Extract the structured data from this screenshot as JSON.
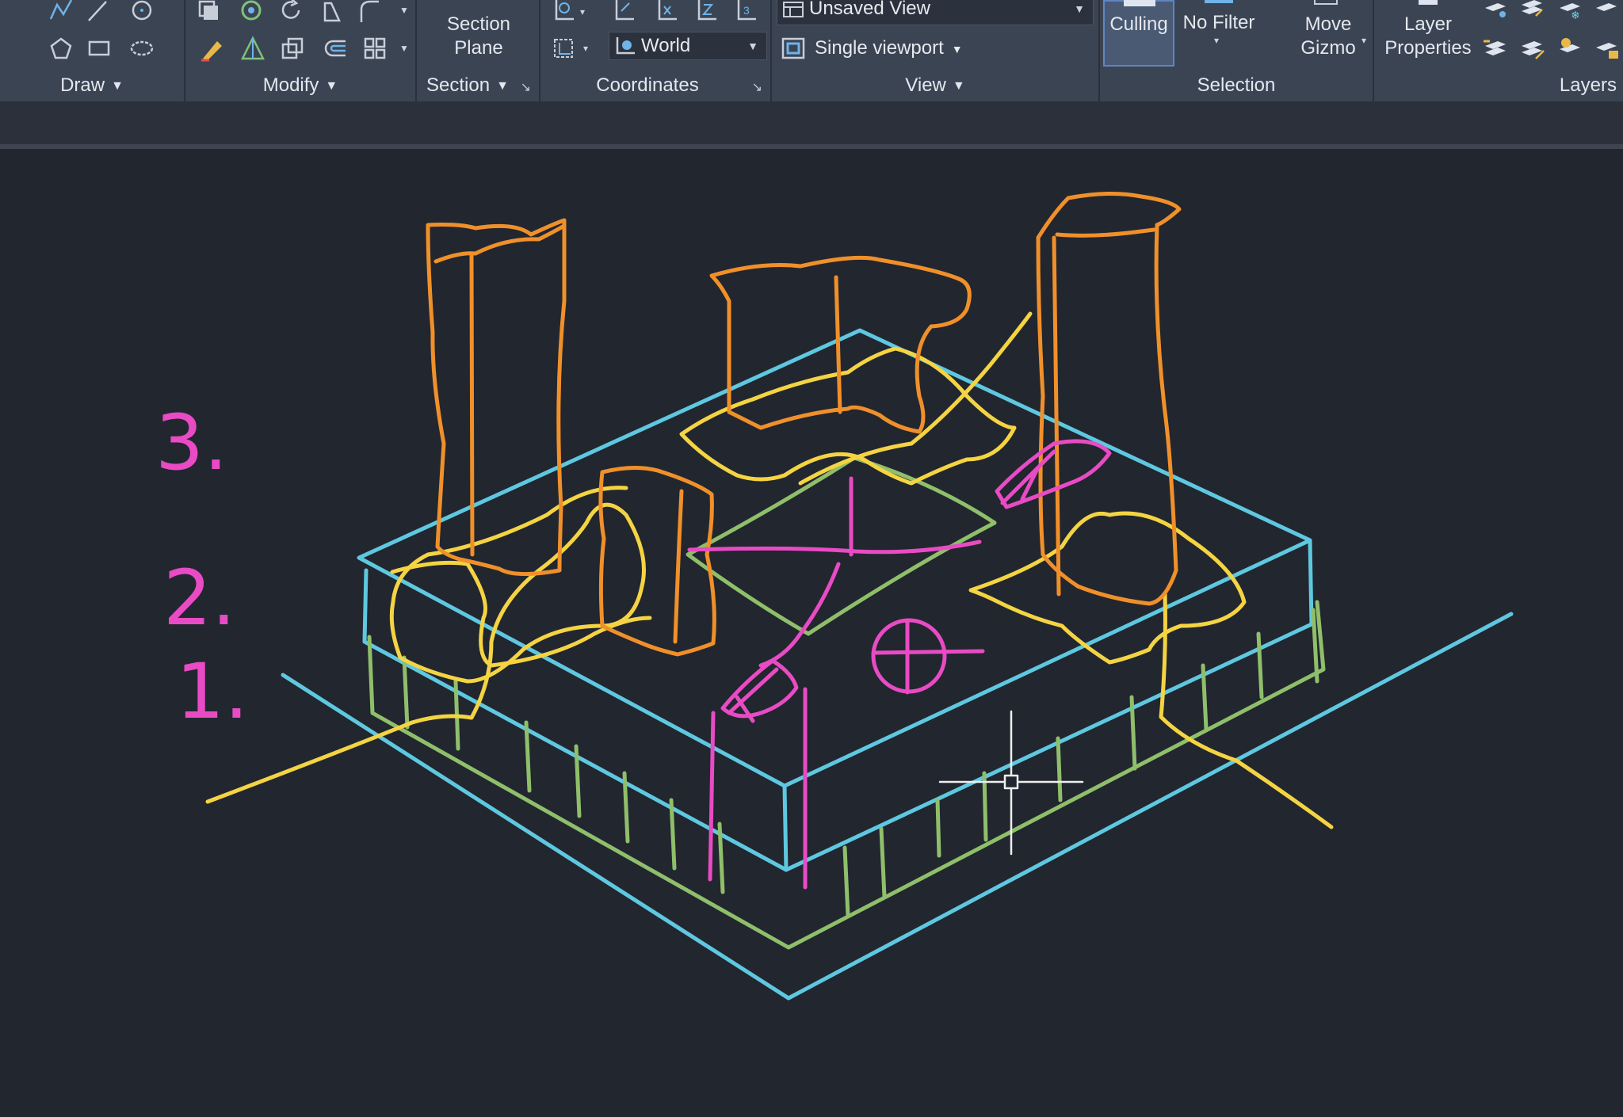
{
  "ribbon": {
    "panels": {
      "draw": {
        "label": "Draw"
      },
      "modify": {
        "label": "Modify"
      },
      "section": {
        "label": "Section",
        "section_plane": "Section\nPlane"
      },
      "coordinates": {
        "label": "Coordinates",
        "ucs_value": "World"
      },
      "view": {
        "label": "View",
        "saved_view": "Unsaved View",
        "viewport": "Single viewport"
      },
      "selection": {
        "label": "Selection",
        "culling": "Culling",
        "no_filter": "No Filter",
        "move_gizmo": "Move\nGizmo"
      },
      "layers": {
        "label": "Layers",
        "layer_properties": "Layer\nProperties"
      }
    }
  },
  "sketch": {
    "labels": [
      "3.",
      "2.",
      "1."
    ],
    "colors": {
      "cyan": "#5ec8e0",
      "green": "#8fbf6a",
      "yellow": "#f4d442",
      "orange": "#f0902a",
      "magenta": "#e84bc4"
    }
  },
  "colors": {
    "ribbon": "#3b4453",
    "workspace": "#22262f"
  }
}
